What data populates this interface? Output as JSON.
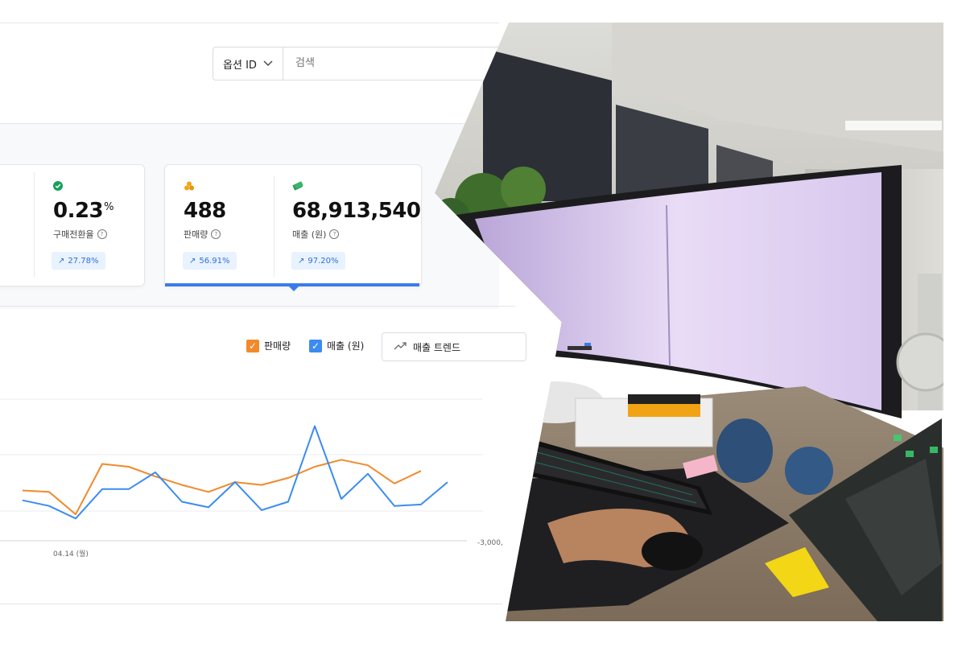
{
  "search": {
    "select_label": "옵션 ID",
    "placeholder": "검색"
  },
  "metrics": [
    {
      "value": "0.23",
      "unit": "%",
      "label": "구매전환율",
      "change": "27.78%",
      "icon": "check-circle-icon",
      "icon_color": "#16a05d"
    },
    {
      "value": "488",
      "unit": "",
      "label": "판매량",
      "change": "56.91%",
      "icon": "coins-icon",
      "icon_color": "#f2a516"
    },
    {
      "value": "68,913,540",
      "unit": "",
      "label": "매출 (원)",
      "change": "97.20%",
      "icon": "money-icon",
      "icon_color": "#2e9b5d"
    }
  ],
  "legend": {
    "sales_qty": {
      "label": "판매량",
      "color": "#f08a2c"
    },
    "revenue": {
      "label": "매출 (원)",
      "color": "#3b8cf0"
    }
  },
  "trend_button": {
    "label": "매출 트렌드",
    "icon": "trend-up-icon"
  },
  "chart_data": {
    "type": "line",
    "x_visible_label": "04.14 (월)",
    "right_axis_visible_label": "-3,000,",
    "series": [
      {
        "name": "판매량",
        "values": [
          29,
          28,
          12,
          48,
          46,
          39,
          33,
          28,
          35,
          33,
          38,
          46,
          51,
          47,
          34,
          43
        ]
      },
      {
        "name": "매출 (원)",
        "values": [
          22,
          18,
          9,
          30,
          30,
          42,
          21,
          17,
          35,
          15,
          21,
          75,
          23,
          41,
          18,
          19,
          35
        ]
      }
    ],
    "grid": true
  },
  "colors": {
    "accent_blue": "#2f6fd6",
    "chip_bg": "#e9f2ff",
    "selected_bar": "#3b7be8"
  }
}
